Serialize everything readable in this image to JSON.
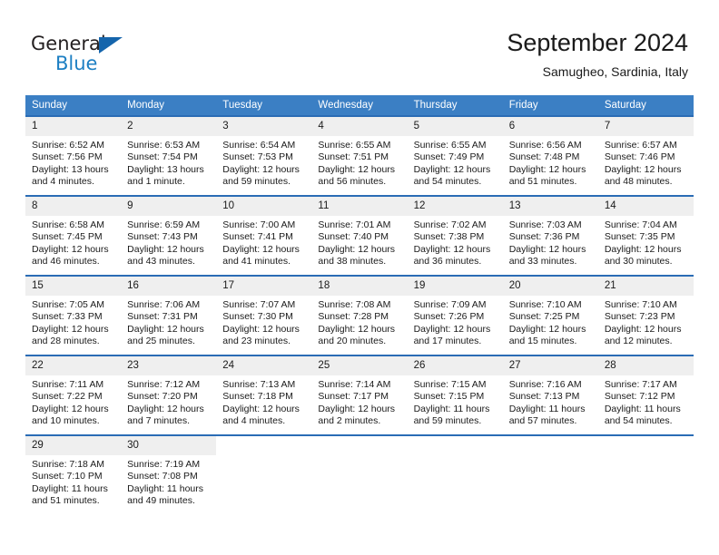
{
  "logo": {
    "word_top": "General",
    "word_bottom": "Blue",
    "triangle_color": "#1565ac",
    "blue_color": "#1d7fc3"
  },
  "header": {
    "title": "September 2024",
    "subtitle": "Samugheo, Sardinia, Italy"
  },
  "theme": {
    "header_blue": "#3b7fc4",
    "row_divider_blue": "#2a6cb5",
    "daynum_band": "#efefef"
  },
  "weekday_headers": [
    "Sunday",
    "Monday",
    "Tuesday",
    "Wednesday",
    "Thursday",
    "Friday",
    "Saturday"
  ],
  "weeks": [
    [
      {
        "day": "1",
        "sunrise": "Sunrise: 6:52 AM",
        "sunset": "Sunset: 7:56 PM",
        "daylight_1": "Daylight: 13 hours",
        "daylight_2": "and 4 minutes."
      },
      {
        "day": "2",
        "sunrise": "Sunrise: 6:53 AM",
        "sunset": "Sunset: 7:54 PM",
        "daylight_1": "Daylight: 13 hours",
        "daylight_2": "and 1 minute."
      },
      {
        "day": "3",
        "sunrise": "Sunrise: 6:54 AM",
        "sunset": "Sunset: 7:53 PM",
        "daylight_1": "Daylight: 12 hours",
        "daylight_2": "and 59 minutes."
      },
      {
        "day": "4",
        "sunrise": "Sunrise: 6:55 AM",
        "sunset": "Sunset: 7:51 PM",
        "daylight_1": "Daylight: 12 hours",
        "daylight_2": "and 56 minutes."
      },
      {
        "day": "5",
        "sunrise": "Sunrise: 6:55 AM",
        "sunset": "Sunset: 7:49 PM",
        "daylight_1": "Daylight: 12 hours",
        "daylight_2": "and 54 minutes."
      },
      {
        "day": "6",
        "sunrise": "Sunrise: 6:56 AM",
        "sunset": "Sunset: 7:48 PM",
        "daylight_1": "Daylight: 12 hours",
        "daylight_2": "and 51 minutes."
      },
      {
        "day": "7",
        "sunrise": "Sunrise: 6:57 AM",
        "sunset": "Sunset: 7:46 PM",
        "daylight_1": "Daylight: 12 hours",
        "daylight_2": "and 48 minutes."
      }
    ],
    [
      {
        "day": "8",
        "sunrise": "Sunrise: 6:58 AM",
        "sunset": "Sunset: 7:45 PM",
        "daylight_1": "Daylight: 12 hours",
        "daylight_2": "and 46 minutes."
      },
      {
        "day": "9",
        "sunrise": "Sunrise: 6:59 AM",
        "sunset": "Sunset: 7:43 PM",
        "daylight_1": "Daylight: 12 hours",
        "daylight_2": "and 43 minutes."
      },
      {
        "day": "10",
        "sunrise": "Sunrise: 7:00 AM",
        "sunset": "Sunset: 7:41 PM",
        "daylight_1": "Daylight: 12 hours",
        "daylight_2": "and 41 minutes."
      },
      {
        "day": "11",
        "sunrise": "Sunrise: 7:01 AM",
        "sunset": "Sunset: 7:40 PM",
        "daylight_1": "Daylight: 12 hours",
        "daylight_2": "and 38 minutes."
      },
      {
        "day": "12",
        "sunrise": "Sunrise: 7:02 AM",
        "sunset": "Sunset: 7:38 PM",
        "daylight_1": "Daylight: 12 hours",
        "daylight_2": "and 36 minutes."
      },
      {
        "day": "13",
        "sunrise": "Sunrise: 7:03 AM",
        "sunset": "Sunset: 7:36 PM",
        "daylight_1": "Daylight: 12 hours",
        "daylight_2": "and 33 minutes."
      },
      {
        "day": "14",
        "sunrise": "Sunrise: 7:04 AM",
        "sunset": "Sunset: 7:35 PM",
        "daylight_1": "Daylight: 12 hours",
        "daylight_2": "and 30 minutes."
      }
    ],
    [
      {
        "day": "15",
        "sunrise": "Sunrise: 7:05 AM",
        "sunset": "Sunset: 7:33 PM",
        "daylight_1": "Daylight: 12 hours",
        "daylight_2": "and 28 minutes."
      },
      {
        "day": "16",
        "sunrise": "Sunrise: 7:06 AM",
        "sunset": "Sunset: 7:31 PM",
        "daylight_1": "Daylight: 12 hours",
        "daylight_2": "and 25 minutes."
      },
      {
        "day": "17",
        "sunrise": "Sunrise: 7:07 AM",
        "sunset": "Sunset: 7:30 PM",
        "daylight_1": "Daylight: 12 hours",
        "daylight_2": "and 23 minutes."
      },
      {
        "day": "18",
        "sunrise": "Sunrise: 7:08 AM",
        "sunset": "Sunset: 7:28 PM",
        "daylight_1": "Daylight: 12 hours",
        "daylight_2": "and 20 minutes."
      },
      {
        "day": "19",
        "sunrise": "Sunrise: 7:09 AM",
        "sunset": "Sunset: 7:26 PM",
        "daylight_1": "Daylight: 12 hours",
        "daylight_2": "and 17 minutes."
      },
      {
        "day": "20",
        "sunrise": "Sunrise: 7:10 AM",
        "sunset": "Sunset: 7:25 PM",
        "daylight_1": "Daylight: 12 hours",
        "daylight_2": "and 15 minutes."
      },
      {
        "day": "21",
        "sunrise": "Sunrise: 7:10 AM",
        "sunset": "Sunset: 7:23 PM",
        "daylight_1": "Daylight: 12 hours",
        "daylight_2": "and 12 minutes."
      }
    ],
    [
      {
        "day": "22",
        "sunrise": "Sunrise: 7:11 AM",
        "sunset": "Sunset: 7:22 PM",
        "daylight_1": "Daylight: 12 hours",
        "daylight_2": "and 10 minutes."
      },
      {
        "day": "23",
        "sunrise": "Sunrise: 7:12 AM",
        "sunset": "Sunset: 7:20 PM",
        "daylight_1": "Daylight: 12 hours",
        "daylight_2": "and 7 minutes."
      },
      {
        "day": "24",
        "sunrise": "Sunrise: 7:13 AM",
        "sunset": "Sunset: 7:18 PM",
        "daylight_1": "Daylight: 12 hours",
        "daylight_2": "and 4 minutes."
      },
      {
        "day": "25",
        "sunrise": "Sunrise: 7:14 AM",
        "sunset": "Sunset: 7:17 PM",
        "daylight_1": "Daylight: 12 hours",
        "daylight_2": "and 2 minutes."
      },
      {
        "day": "26",
        "sunrise": "Sunrise: 7:15 AM",
        "sunset": "Sunset: 7:15 PM",
        "daylight_1": "Daylight: 11 hours",
        "daylight_2": "and 59 minutes."
      },
      {
        "day": "27",
        "sunrise": "Sunrise: 7:16 AM",
        "sunset": "Sunset: 7:13 PM",
        "daylight_1": "Daylight: 11 hours",
        "daylight_2": "and 57 minutes."
      },
      {
        "day": "28",
        "sunrise": "Sunrise: 7:17 AM",
        "sunset": "Sunset: 7:12 PM",
        "daylight_1": "Daylight: 11 hours",
        "daylight_2": "and 54 minutes."
      }
    ],
    [
      {
        "day": "29",
        "sunrise": "Sunrise: 7:18 AM",
        "sunset": "Sunset: 7:10 PM",
        "daylight_1": "Daylight: 11 hours",
        "daylight_2": "and 51 minutes."
      },
      {
        "day": "30",
        "sunrise": "Sunrise: 7:19 AM",
        "sunset": "Sunset: 7:08 PM",
        "daylight_1": "Daylight: 11 hours",
        "daylight_2": "and 49 minutes."
      },
      {
        "day": "",
        "sunrise": "",
        "sunset": "",
        "daylight_1": "",
        "daylight_2": ""
      },
      {
        "day": "",
        "sunrise": "",
        "sunset": "",
        "daylight_1": "",
        "daylight_2": ""
      },
      {
        "day": "",
        "sunrise": "",
        "sunset": "",
        "daylight_1": "",
        "daylight_2": ""
      },
      {
        "day": "",
        "sunrise": "",
        "sunset": "",
        "daylight_1": "",
        "daylight_2": ""
      },
      {
        "day": "",
        "sunrise": "",
        "sunset": "",
        "daylight_1": "",
        "daylight_2": ""
      }
    ]
  ]
}
